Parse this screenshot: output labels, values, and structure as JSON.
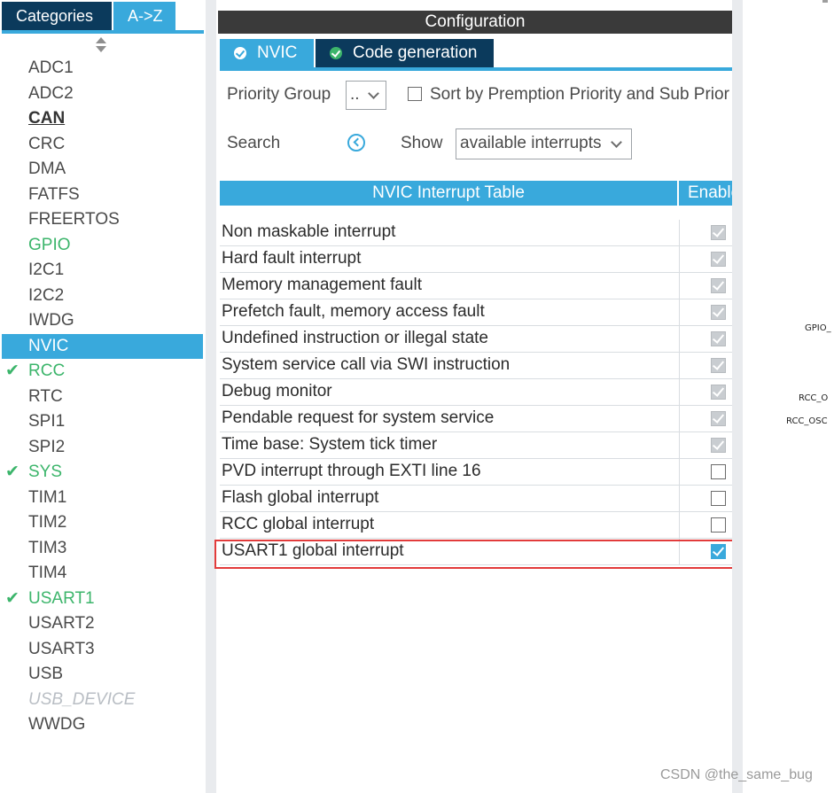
{
  "left_panel": {
    "tabs": {
      "categories": "Categories",
      "az": "A->Z"
    },
    "items": [
      {
        "label": "ADC1",
        "style": "normal",
        "check": false,
        "selected": false
      },
      {
        "label": "ADC2",
        "style": "normal",
        "check": false,
        "selected": false
      },
      {
        "label": "CAN",
        "style": "bold",
        "check": false,
        "selected": false
      },
      {
        "label": "CRC",
        "style": "normal",
        "check": false,
        "selected": false
      },
      {
        "label": "DMA",
        "style": "normal",
        "check": false,
        "selected": false
      },
      {
        "label": "FATFS",
        "style": "normal",
        "check": false,
        "selected": false
      },
      {
        "label": "FREERTOS",
        "style": "normal",
        "check": false,
        "selected": false
      },
      {
        "label": "GPIO",
        "style": "green",
        "check": false,
        "selected": false
      },
      {
        "label": "I2C1",
        "style": "normal",
        "check": false,
        "selected": false
      },
      {
        "label": "I2C2",
        "style": "normal",
        "check": false,
        "selected": false
      },
      {
        "label": "IWDG",
        "style": "normal",
        "check": false,
        "selected": false
      },
      {
        "label": "NVIC",
        "style": "normal",
        "check": false,
        "selected": true
      },
      {
        "label": "RCC",
        "style": "green",
        "check": true,
        "selected": false
      },
      {
        "label": "RTC",
        "style": "normal",
        "check": false,
        "selected": false
      },
      {
        "label": "SPI1",
        "style": "normal",
        "check": false,
        "selected": false
      },
      {
        "label": "SPI2",
        "style": "normal",
        "check": false,
        "selected": false
      },
      {
        "label": "SYS",
        "style": "green",
        "check": true,
        "selected": false
      },
      {
        "label": "TIM1",
        "style": "normal",
        "check": false,
        "selected": false
      },
      {
        "label": "TIM2",
        "style": "normal",
        "check": false,
        "selected": false
      },
      {
        "label": "TIM3",
        "style": "normal",
        "check": false,
        "selected": false
      },
      {
        "label": "TIM4",
        "style": "normal",
        "check": false,
        "selected": false
      },
      {
        "label": "USART1",
        "style": "green",
        "check": true,
        "selected": false
      },
      {
        "label": "USART2",
        "style": "normal",
        "check": false,
        "selected": false
      },
      {
        "label": "USART3",
        "style": "normal",
        "check": false,
        "selected": false
      },
      {
        "label": "USB",
        "style": "normal",
        "check": false,
        "selected": false
      },
      {
        "label": "USB_DEVICE",
        "style": "italic",
        "check": false,
        "selected": false
      },
      {
        "label": "WWDG",
        "style": "normal",
        "check": false,
        "selected": false
      }
    ]
  },
  "config": {
    "title": "Configuration",
    "tabs": {
      "nvic": "NVIC",
      "code_generation": "Code generation"
    },
    "priority_group": {
      "label": "Priority Group",
      "value": ".."
    },
    "sort": {
      "label": "Sort by Premption Priority and Sub Priority",
      "checked": false
    },
    "search": {
      "label": "Search"
    },
    "show": {
      "label": "Show",
      "value": "available interrupts"
    },
    "table": {
      "header_name": "NVIC Interrupt Table",
      "header_enabled": "Enabled",
      "rows": [
        {
          "name": "Non maskable interrupt",
          "enabled": true,
          "locked": true
        },
        {
          "name": "Hard fault interrupt",
          "enabled": true,
          "locked": true
        },
        {
          "name": "Memory management fault",
          "enabled": true,
          "locked": true
        },
        {
          "name": "Prefetch fault, memory access fault",
          "enabled": true,
          "locked": true
        },
        {
          "name": "Undefined instruction or illegal state",
          "enabled": true,
          "locked": true
        },
        {
          "name": "System service call via SWI instruction",
          "enabled": true,
          "locked": true
        },
        {
          "name": "Debug monitor",
          "enabled": true,
          "locked": true
        },
        {
          "name": "Pendable request for system service",
          "enabled": true,
          "locked": true
        },
        {
          "name": "Time base: System tick timer",
          "enabled": true,
          "locked": true
        },
        {
          "name": "PVD interrupt through EXTI line 16",
          "enabled": false,
          "locked": false
        },
        {
          "name": "Flash global interrupt",
          "enabled": false,
          "locked": false
        },
        {
          "name": "RCC global interrupt",
          "enabled": false,
          "locked": false
        },
        {
          "name": "USART1 global interrupt",
          "enabled": true,
          "locked": false
        }
      ]
    }
  },
  "chip_pins": {
    "gpio": "GPIO_",
    "rcc_1": "RCC_O",
    "rcc_2": "RCC_OSC"
  },
  "colors": {
    "accent": "#39a9dc",
    "dark_tab": "#0b3a5c",
    "title_bar": "#3a3a3a",
    "ok_green": "#3cb56b",
    "highlight_red": "#e23b3b"
  },
  "watermark": "CSDN @the_same_bug"
}
